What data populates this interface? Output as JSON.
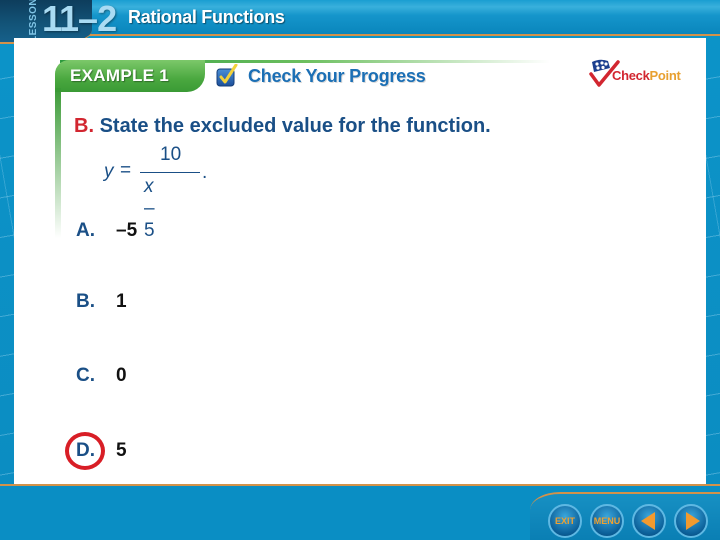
{
  "header": {
    "lesson_label": "LESSON",
    "lesson_number": "11–2",
    "lesson_title": "Rational Functions"
  },
  "banner": {
    "example_label": "EXAMPLE 1",
    "check_progress_label": "Check Your Progress",
    "icon": "checkbox-checked-icon"
  },
  "logo": {
    "part1": "Check",
    "part2": "Point",
    "icon": "checkpoint-check-icon"
  },
  "question": {
    "part_label": "B.",
    "text": "State the excluded value for the function.",
    "equation": {
      "lhs": "y",
      "equals": "=",
      "numerator": "10",
      "denominator_var": "x",
      "denominator_rest": " – 5",
      "trailing": "."
    }
  },
  "options": [
    {
      "letter": "A.",
      "value": "–5",
      "selected": false
    },
    {
      "letter": "B.",
      "value": "1",
      "selected": false
    },
    {
      "letter": "C.",
      "value": "0",
      "selected": false
    },
    {
      "letter": "D.",
      "value": "5",
      "selected": true
    }
  ],
  "nav": {
    "exit_label": "EXIT",
    "menu_label": "MENU",
    "prev_icon": "previous-arrow-icon",
    "next_icon": "next-arrow-icon"
  },
  "colors": {
    "frame_blue": "#0a8ec4",
    "title_blue": "#1a4f86",
    "accent_red": "#d22630",
    "example_green": "#4aa83f",
    "orange_rule": "#d2924a"
  }
}
